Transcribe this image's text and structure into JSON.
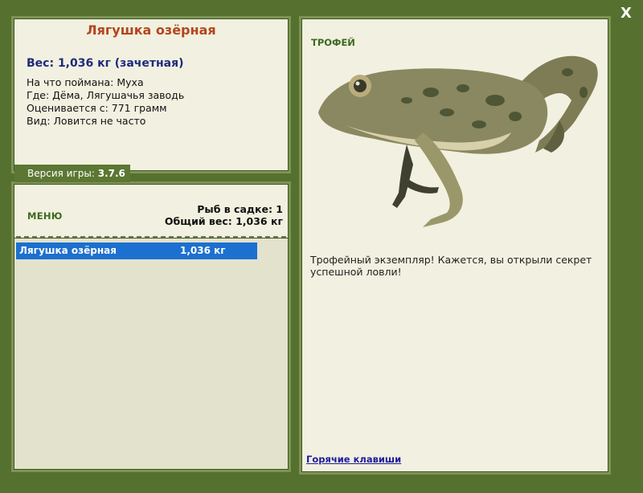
{
  "fish": {
    "name": "Лягушка озёрная",
    "weight_line": "Вес: 1,036 кг (зачетная)",
    "caught_on": "На что поймана: Муха",
    "location": "Где: Дёма, Лягушачья заводь",
    "valued_from": "Оценивается с: 771 грамм",
    "kind": "Вид: Ловится не часто"
  },
  "version": {
    "label": "Версия игры:",
    "value": "3.7.6"
  },
  "menu_label": "МЕНЮ",
  "keepnet": {
    "count_line": "Рыб в садке: 1",
    "total_line": "Общий вес: 1,036 кг"
  },
  "catch_list": [
    {
      "name": "Лягушка озёрная",
      "weight": "1,036 кг"
    }
  ],
  "trophy": {
    "heading": "ТРОФЕЙ",
    "description": "Трофейный экземпляр! Кажется, вы открыли секрет успешной ловли!"
  },
  "hotkeys_link": "Горячие клавиши",
  "close_glyph": "X",
  "colors": {
    "frame_bg": "#55702f",
    "panel_bg": "#f2f0e0",
    "selected_row": "#1c70d0",
    "title": "#b3461c"
  }
}
